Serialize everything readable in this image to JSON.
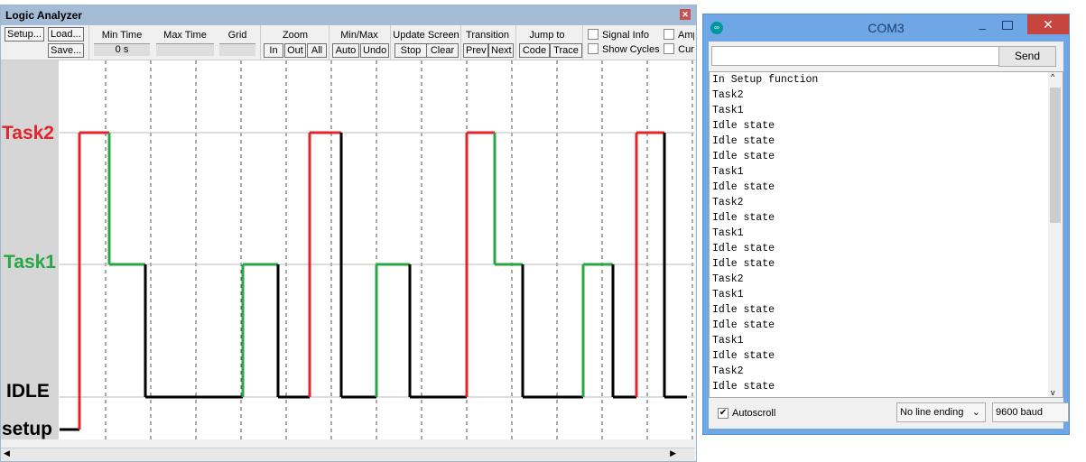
{
  "logic_analyzer": {
    "title": "Logic Analyzer",
    "buttons": {
      "setup": "Setup...",
      "load": "Load...",
      "save": "Save..."
    },
    "min_time_label": "Min Time",
    "min_time_value": "0 s",
    "max_time_label": "Max Time",
    "grid_label": "Grid",
    "zoom": {
      "label": "Zoom",
      "in": "In",
      "out": "Out",
      "all": "All"
    },
    "minmax": {
      "label": "Min/Max",
      "auto": "Auto",
      "undo": "Undo"
    },
    "update": {
      "label": "Update Screen",
      "stop": "Stop",
      "clear": "Clear"
    },
    "transition": {
      "label": "Transition",
      "prev": "Prev",
      "next": "Next"
    },
    "jump": {
      "label": "Jump to",
      "code": "Code",
      "trace": "Trace"
    },
    "signal_info": "Signal Info",
    "show_cycles": "Show Cycles",
    "amp": "Amp",
    "cur": "Cur",
    "levels": {
      "task2": "Task2",
      "task1": "Task1",
      "idle": "IDLE",
      "setup": "setup"
    },
    "colors": {
      "task2": "#e0262b",
      "task1": "#27a745",
      "idle": "#000000",
      "setup": "#000000"
    },
    "trace": [
      [
        "setup",
        0
      ],
      [
        "task2",
        0.44
      ],
      [
        "task1",
        1.1
      ],
      [
        "idle",
        1.9
      ],
      [
        "task1",
        4.06
      ],
      [
        "idle",
        4.84
      ],
      [
        "task2",
        5.54
      ],
      [
        "idle",
        6.24
      ],
      [
        "task1",
        7.02
      ],
      [
        "idle",
        7.76
      ],
      [
        "task2",
        9.02
      ],
      [
        "task1",
        9.64
      ],
      [
        "idle",
        10.26
      ],
      [
        "task1",
        11.6
      ],
      [
        "idle",
        12.26
      ],
      [
        "task2",
        12.78
      ],
      [
        "idle",
        13.4
      ],
      [
        "end",
        13.9
      ]
    ]
  },
  "serial_monitor": {
    "title": "COM3",
    "send": "Send",
    "lines": [
      "In Setup function",
      "Task2",
      "Task1",
      "Idle state",
      "Idle state",
      "Idle state",
      "Task1",
      "Idle state",
      "Task2",
      "Idle state",
      "Task1",
      "Idle state",
      "Idle state",
      "Task2",
      "Task1",
      "Idle state",
      "Idle state",
      "Task1",
      "Idle state",
      "Task2",
      "Idle state"
    ],
    "autoscroll": "Autoscroll",
    "line_ending": "No line ending",
    "baud": "9600 baud"
  }
}
